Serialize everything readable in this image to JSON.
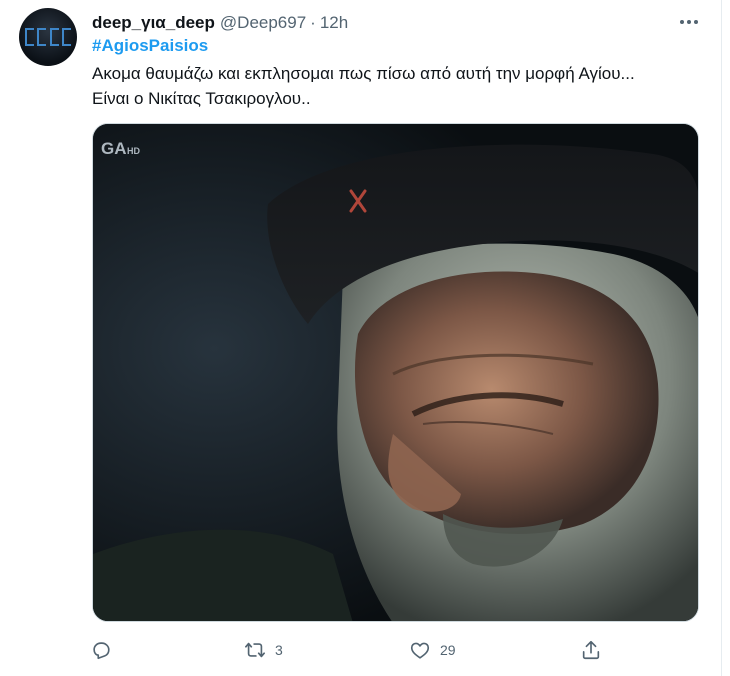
{
  "tweet": {
    "display_name": "deep_για_deep",
    "handle": "@Deep697",
    "separator": "·",
    "time": "12h",
    "hashtag": "#AgiosPaisios",
    "text_line1": "Ακομα θαυμάζω και εκπλησομαι  πως πίσω από αυτή την μορφή Αγίου...",
    "text_line2": "Είναι ο Νικίτας Τσακιρογλου..",
    "media": {
      "watermark": "GA",
      "watermark_suffix": "HD"
    },
    "actions": {
      "reply_count": "",
      "retweet_count": "3",
      "like_count": "29"
    }
  },
  "colors": {
    "accent": "#1d9bf0",
    "secondary_text": "#536471",
    "primary_text": "#0f1419"
  },
  "icons": {
    "more": "more-horizontal-icon",
    "reply": "reply-icon",
    "retweet": "retweet-icon",
    "like": "heart-icon",
    "share": "share-icon"
  }
}
